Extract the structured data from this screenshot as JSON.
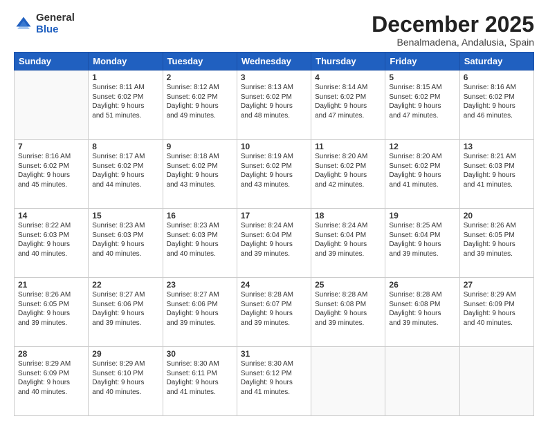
{
  "header": {
    "logo_general": "General",
    "logo_blue": "Blue",
    "month_title": "December 2025",
    "subtitle": "Benalmadena, Andalusia, Spain"
  },
  "days_of_week": [
    "Sunday",
    "Monday",
    "Tuesday",
    "Wednesday",
    "Thursday",
    "Friday",
    "Saturday"
  ],
  "weeks": [
    [
      {
        "day": "",
        "content": ""
      },
      {
        "day": "1",
        "content": "Sunrise: 8:11 AM\nSunset: 6:02 PM\nDaylight: 9 hours\nand 51 minutes."
      },
      {
        "day": "2",
        "content": "Sunrise: 8:12 AM\nSunset: 6:02 PM\nDaylight: 9 hours\nand 49 minutes."
      },
      {
        "day": "3",
        "content": "Sunrise: 8:13 AM\nSunset: 6:02 PM\nDaylight: 9 hours\nand 48 minutes."
      },
      {
        "day": "4",
        "content": "Sunrise: 8:14 AM\nSunset: 6:02 PM\nDaylight: 9 hours\nand 47 minutes."
      },
      {
        "day": "5",
        "content": "Sunrise: 8:15 AM\nSunset: 6:02 PM\nDaylight: 9 hours\nand 47 minutes."
      },
      {
        "day": "6",
        "content": "Sunrise: 8:16 AM\nSunset: 6:02 PM\nDaylight: 9 hours\nand 46 minutes."
      }
    ],
    [
      {
        "day": "7",
        "content": "Sunrise: 8:16 AM\nSunset: 6:02 PM\nDaylight: 9 hours\nand 45 minutes."
      },
      {
        "day": "8",
        "content": "Sunrise: 8:17 AM\nSunset: 6:02 PM\nDaylight: 9 hours\nand 44 minutes."
      },
      {
        "day": "9",
        "content": "Sunrise: 8:18 AM\nSunset: 6:02 PM\nDaylight: 9 hours\nand 43 minutes."
      },
      {
        "day": "10",
        "content": "Sunrise: 8:19 AM\nSunset: 6:02 PM\nDaylight: 9 hours\nand 43 minutes."
      },
      {
        "day": "11",
        "content": "Sunrise: 8:20 AM\nSunset: 6:02 PM\nDaylight: 9 hours\nand 42 minutes."
      },
      {
        "day": "12",
        "content": "Sunrise: 8:20 AM\nSunset: 6:02 PM\nDaylight: 9 hours\nand 41 minutes."
      },
      {
        "day": "13",
        "content": "Sunrise: 8:21 AM\nSunset: 6:03 PM\nDaylight: 9 hours\nand 41 minutes."
      }
    ],
    [
      {
        "day": "14",
        "content": "Sunrise: 8:22 AM\nSunset: 6:03 PM\nDaylight: 9 hours\nand 40 minutes."
      },
      {
        "day": "15",
        "content": "Sunrise: 8:23 AM\nSunset: 6:03 PM\nDaylight: 9 hours\nand 40 minutes."
      },
      {
        "day": "16",
        "content": "Sunrise: 8:23 AM\nSunset: 6:03 PM\nDaylight: 9 hours\nand 40 minutes."
      },
      {
        "day": "17",
        "content": "Sunrise: 8:24 AM\nSunset: 6:04 PM\nDaylight: 9 hours\nand 39 minutes."
      },
      {
        "day": "18",
        "content": "Sunrise: 8:24 AM\nSunset: 6:04 PM\nDaylight: 9 hours\nand 39 minutes."
      },
      {
        "day": "19",
        "content": "Sunrise: 8:25 AM\nSunset: 6:04 PM\nDaylight: 9 hours\nand 39 minutes."
      },
      {
        "day": "20",
        "content": "Sunrise: 8:26 AM\nSunset: 6:05 PM\nDaylight: 9 hours\nand 39 minutes."
      }
    ],
    [
      {
        "day": "21",
        "content": "Sunrise: 8:26 AM\nSunset: 6:05 PM\nDaylight: 9 hours\nand 39 minutes."
      },
      {
        "day": "22",
        "content": "Sunrise: 8:27 AM\nSunset: 6:06 PM\nDaylight: 9 hours\nand 39 minutes."
      },
      {
        "day": "23",
        "content": "Sunrise: 8:27 AM\nSunset: 6:06 PM\nDaylight: 9 hours\nand 39 minutes."
      },
      {
        "day": "24",
        "content": "Sunrise: 8:28 AM\nSunset: 6:07 PM\nDaylight: 9 hours\nand 39 minutes."
      },
      {
        "day": "25",
        "content": "Sunrise: 8:28 AM\nSunset: 6:08 PM\nDaylight: 9 hours\nand 39 minutes."
      },
      {
        "day": "26",
        "content": "Sunrise: 8:28 AM\nSunset: 6:08 PM\nDaylight: 9 hours\nand 39 minutes."
      },
      {
        "day": "27",
        "content": "Sunrise: 8:29 AM\nSunset: 6:09 PM\nDaylight: 9 hours\nand 40 minutes."
      }
    ],
    [
      {
        "day": "28",
        "content": "Sunrise: 8:29 AM\nSunset: 6:09 PM\nDaylight: 9 hours\nand 40 minutes."
      },
      {
        "day": "29",
        "content": "Sunrise: 8:29 AM\nSunset: 6:10 PM\nDaylight: 9 hours\nand 40 minutes."
      },
      {
        "day": "30",
        "content": "Sunrise: 8:30 AM\nSunset: 6:11 PM\nDaylight: 9 hours\nand 41 minutes."
      },
      {
        "day": "31",
        "content": "Sunrise: 8:30 AM\nSunset: 6:12 PM\nDaylight: 9 hours\nand 41 minutes."
      },
      {
        "day": "",
        "content": ""
      },
      {
        "day": "",
        "content": ""
      },
      {
        "day": "",
        "content": ""
      }
    ]
  ]
}
